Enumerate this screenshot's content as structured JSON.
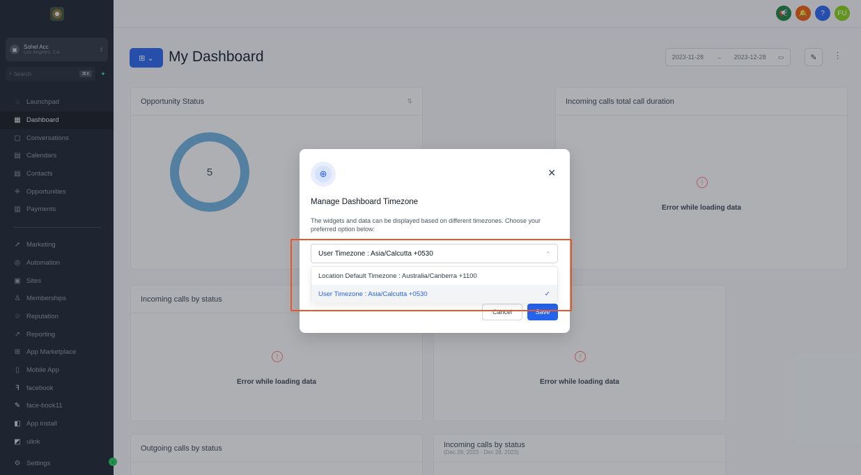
{
  "sidebar": {
    "account": {
      "name": "Sohel Acc",
      "location": "Los Angeles, CA"
    },
    "search": {
      "placeholder": "Search",
      "shortcut": "⌘K"
    },
    "items": [
      {
        "label": "Launchpad",
        "icon": "rocket-icon"
      },
      {
        "label": "Dashboard",
        "icon": "grid-icon",
        "active": true
      },
      {
        "label": "Conversations",
        "icon": "chat-icon"
      },
      {
        "label": "Calendars",
        "icon": "calendar-icon"
      },
      {
        "label": "Contacts",
        "icon": "contacts-icon"
      },
      {
        "label": "Opportunities",
        "icon": "opportunities-icon"
      },
      {
        "label": "Payments",
        "icon": "payments-icon"
      }
    ],
    "items2": [
      {
        "label": "Marketing",
        "icon": "send-icon"
      },
      {
        "label": "Automation",
        "icon": "automation-icon"
      },
      {
        "label": "Sites",
        "icon": "sites-icon"
      },
      {
        "label": "Memberships",
        "icon": "memberships-icon"
      },
      {
        "label": "Reputation",
        "icon": "star-icon"
      },
      {
        "label": "Reporting",
        "icon": "reporting-icon"
      },
      {
        "label": "App Marketplace",
        "icon": "marketplace-icon"
      },
      {
        "label": "Mobile App",
        "icon": "mobile-icon"
      },
      {
        "label": "facebook",
        "icon": "facebook-icon"
      },
      {
        "label": "face-book11",
        "icon": "face-book-icon"
      },
      {
        "label": "App install",
        "icon": "app-install-icon"
      },
      {
        "label": "ulink",
        "icon": "link-icon"
      }
    ],
    "settings": "Settings"
  },
  "topbar": {
    "user_initials": "FU"
  },
  "header": {
    "title": "My Dashboard",
    "date_start": "2023-11-28",
    "date_end": "2023-12-28"
  },
  "cards": {
    "opportunity": {
      "title": "Opportunity Status",
      "value": "5"
    },
    "calls_duration": {
      "title": "Incoming calls total call duration",
      "error": "Error while loading data"
    },
    "calls_status": {
      "title": "Incoming calls by status",
      "error": "Error while loading data"
    },
    "card_mid": {
      "error": "Error while loading data"
    },
    "outgoing": {
      "title": "Outgoing calls by status"
    },
    "calls_status2": {
      "title": "Incoming calls by status",
      "subtitle": "(Dec 28, 2023 - Dec 28, 2023)"
    }
  },
  "modal": {
    "title": "Manage Dashboard Timezone",
    "description": "The widgets and data can be displayed based on different timezones. Choose your preferred option below:",
    "selected_value": "User Timezone : Asia/Calcutta +0530",
    "options": [
      "Location Default Timezone : Australia/Canberra +1100",
      "User Timezone : Asia/Calcutta +0530"
    ],
    "cancel": "Cancel",
    "save": "Save"
  }
}
